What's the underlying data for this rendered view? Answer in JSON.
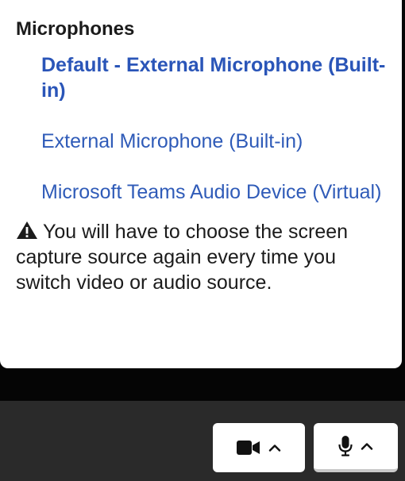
{
  "microphones": {
    "title": "Microphones",
    "devices": [
      {
        "label": "Default - External Microphone (Built-in)",
        "selected": true
      },
      {
        "label": "External Microphone (Built-in)",
        "selected": false
      },
      {
        "label": "Microsoft Teams Audio Device (Virtual)",
        "selected": false
      }
    ],
    "warning": "You will have to choose the screen capture source again every time you switch video or audio source.",
    "warning_icon": "warning-triangle-icon"
  },
  "toolbar": {
    "video_icon": "video-camera-icon",
    "video_chevron_icon": "chevron-up-icon",
    "mic_icon": "microphone-icon",
    "mic_chevron_icon": "chevron-up-icon"
  },
  "colors": {
    "link": "#2f5bb8",
    "text": "#1b1b1b",
    "toolbar_bg": "#2a2a2a",
    "backdrop": "#050505"
  }
}
